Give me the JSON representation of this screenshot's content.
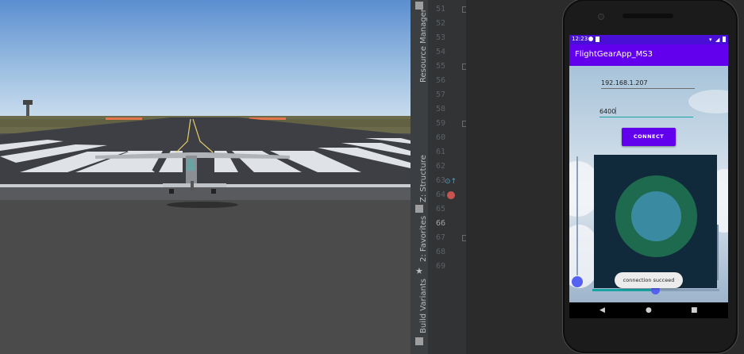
{
  "simulator": {
    "scene": "runway-view"
  },
  "ide": {
    "tool_windows": [
      "Resource Manager",
      "Z: Structure",
      "2: Favorites",
      "Build Variants"
    ],
    "line_numbers": [
      "51",
      "52",
      "53",
      "54",
      "55",
      "56",
      "57",
      "58",
      "59",
      "60",
      "61",
      "62",
      "63",
      "64",
      "65",
      "66",
      "67",
      "68",
      "69"
    ],
    "current_line": "66"
  },
  "phone": {
    "status": {
      "time": "12:23"
    },
    "app_title": "FlightGearApp_MS3",
    "ip_field": {
      "value": "192.168.1.207"
    },
    "port_field": {
      "value": "6400"
    },
    "connect_label": "CONNECT",
    "toast": "connection succeed",
    "nav": {
      "back": "◀",
      "home": "●",
      "recents": "■"
    },
    "colors": {
      "primary": "#6200ee",
      "status": "#4a0fd6",
      "joystick_outer": "#1e6a4e",
      "joystick_inner": "#3a8ba1",
      "panel": "#112a3b"
    }
  }
}
